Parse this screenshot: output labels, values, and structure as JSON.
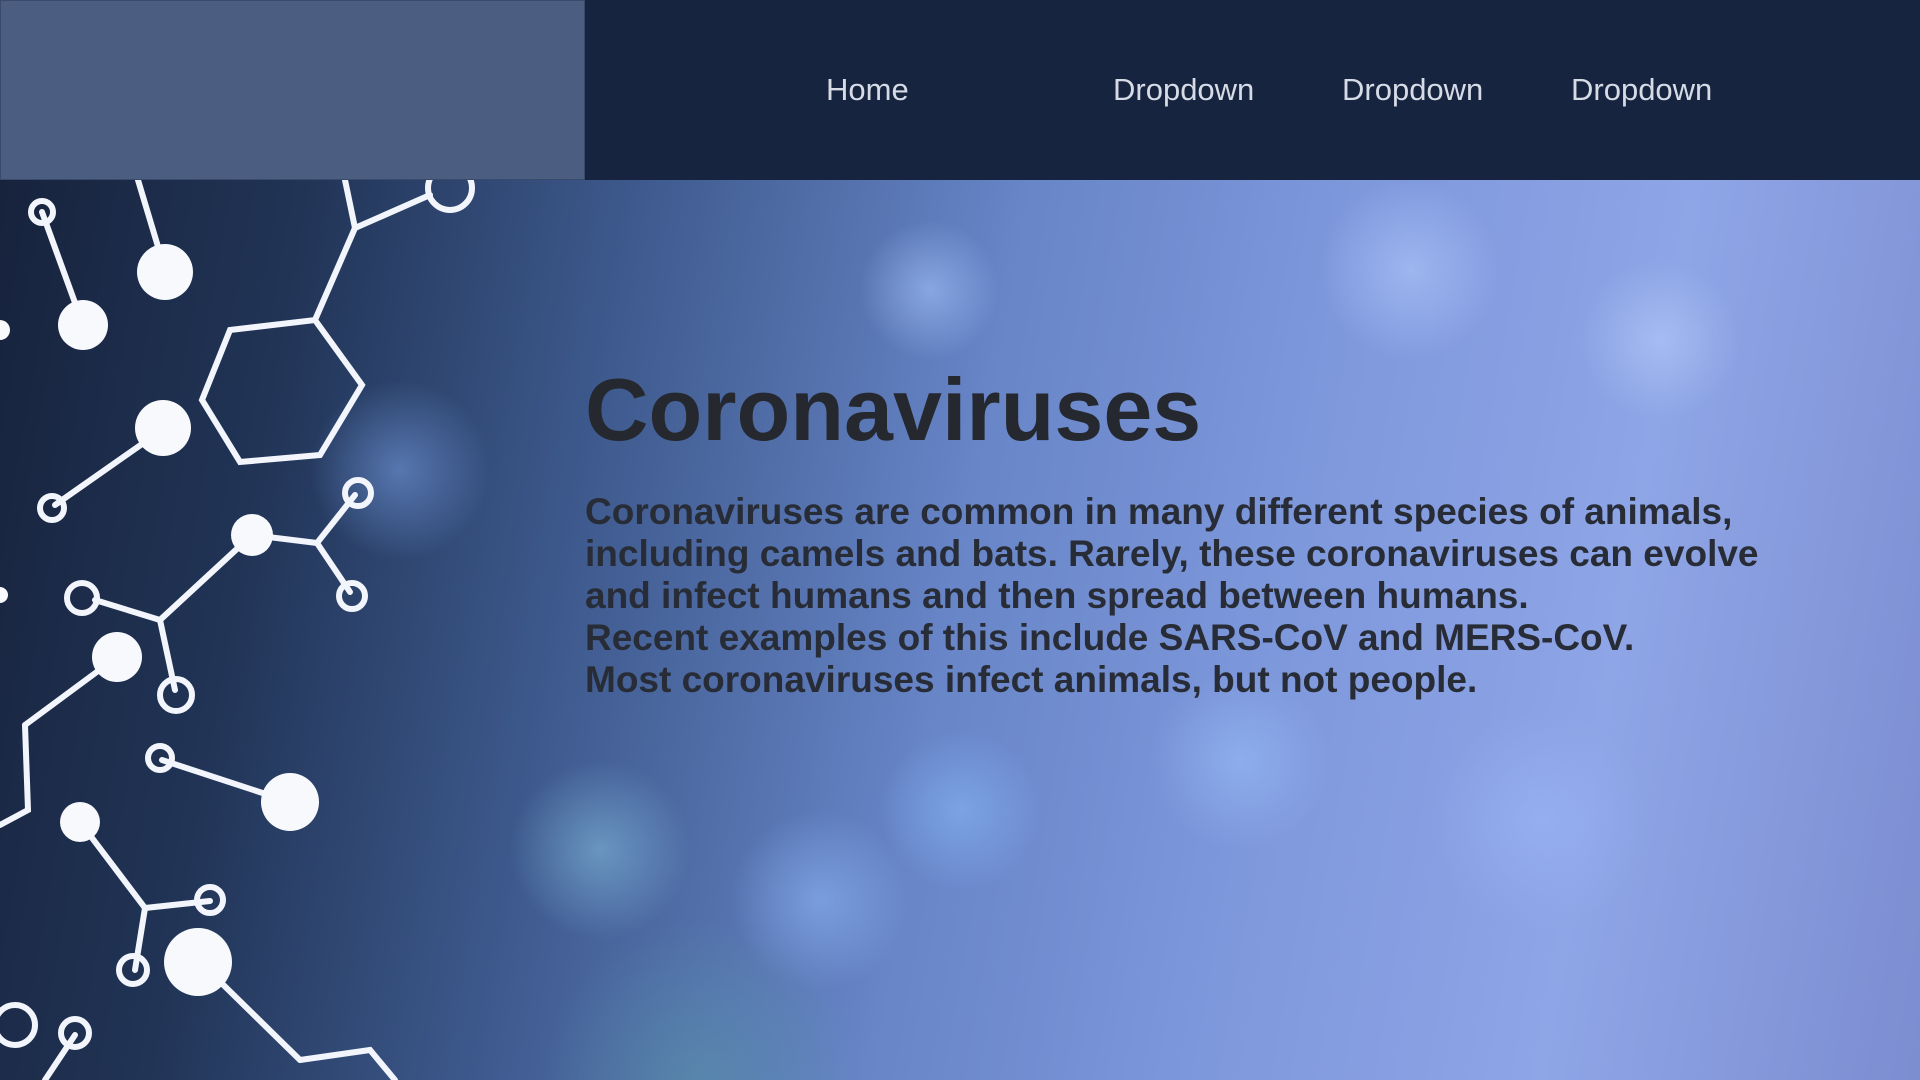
{
  "nav": {
    "items": [
      {
        "label": "Home"
      },
      {
        "label": "Dropdown"
      },
      {
        "label": "Dropdown"
      },
      {
        "label": "Dropdown"
      }
    ]
  },
  "hero": {
    "title": "Coronaviruses",
    "paragraph_lines": [
      "Coronaviruses are common in many different species of animals,",
      "including camels and bats. Rarely, these coronaviruses can evolve",
      "and infect humans and then spread between humans.",
      "Recent examples of this include SARS-CoV and MERS-CoV.",
      "Most coronaviruses infect animals, but not people."
    ],
    "background_image": "molecule-structure-illustration"
  },
  "colors": {
    "navbar_bg": "#16243f",
    "logo_box_bg": "#4b5d80",
    "nav_text": "#d6dbe6",
    "title_text": "#25292f"
  }
}
